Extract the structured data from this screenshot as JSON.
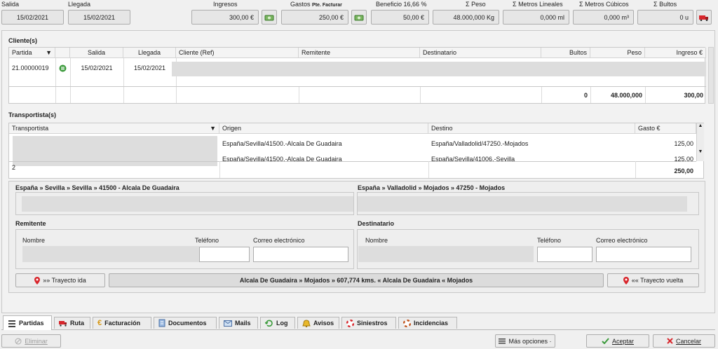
{
  "header": {
    "salida_label": "Salida",
    "salida_value": "15/02/2021",
    "llegada_label": "Llegada",
    "llegada_value": "15/02/2021",
    "ingresos_label": "Ingresos",
    "ingresos_value": "300,00 €",
    "gastos_label": "Gastos",
    "gastos_sub": "Pte. Facturar",
    "gastos_value": "250,00 €",
    "beneficio_label": "Beneficio 16,66 %",
    "beneficio_value": "50,00 €",
    "peso_label": "Σ Peso",
    "peso_value": "48.000,000 Kg",
    "metros_lineales_label": "Σ Metros Lineales",
    "metros_lineales_value": "0,000 ml",
    "metros_cubicos_label": "Σ Metros Cúbicos",
    "metros_cubicos_value": "0,000 m³",
    "bultos_label": "Σ Bultos",
    "bultos_value": "0 u"
  },
  "clientes": {
    "title": "Cliente(s)",
    "columns": [
      "Partida",
      "",
      "Salida",
      "Llegada",
      "Cliente (Ref)",
      "Remitente",
      "Destinatario",
      "Bultos",
      "Peso",
      "Ingreso €"
    ],
    "row": {
      "partida": "21.00000019",
      "salida": "15/02/2021",
      "llegada": "15/02/2021"
    },
    "totals": {
      "bultos": "0",
      "peso": "48.000,000",
      "ingreso": "300,00"
    }
  },
  "transportistas": {
    "title": "Transportista(s)",
    "columns": [
      "Transportista",
      "Origen",
      "Destino",
      "Gasto €"
    ],
    "rows": [
      {
        "origen": "España/Sevilla/41500.-Alcala De Guadaira",
        "destino": "España/Valladolid/47250.-Mojados",
        "gasto": "125,00"
      },
      {
        "origen": "España/Sevilla/41500.-Alcala De Guadaira",
        "destino": "España/Sevilla/41006.-Sevilla",
        "gasto": "125,00"
      }
    ],
    "footer_left": "2",
    "total": "250,00"
  },
  "detalle": {
    "origen_title": "España » Sevilla » Sevilla » 41500 - Alcala De Guadaira",
    "destino_title": "España » Valladolid » Mojados » 47250 - Mojados",
    "remitente_title": "Remitente",
    "destinatario_title": "Destinatario",
    "nombre_label": "Nombre",
    "telefono_label": "Teléfono",
    "correo_label": "Correo electrónico",
    "trayecto_ida": "»» Trayecto ida",
    "trayecto_vuelta": "«« Trayecto vuelta",
    "ruta_resumen": "Alcala De Guadaira » Mojados » 607,774 kms.  « Alcala De Guadaira « Mojados"
  },
  "tabs": [
    "Partidas",
    "Ruta",
    "Facturación",
    "Documentos",
    "Mails",
    "Log",
    "Avisos",
    "Siniestros",
    "Incidencias"
  ],
  "footer": {
    "eliminar": "Eliminar",
    "mas_opciones": "Más opciones ·",
    "aceptar": "Aceptar",
    "cancelar": "Cancelar"
  },
  "colors": {
    "accent_red": "#d8262c",
    "accent_green": "#3a9a3a"
  }
}
